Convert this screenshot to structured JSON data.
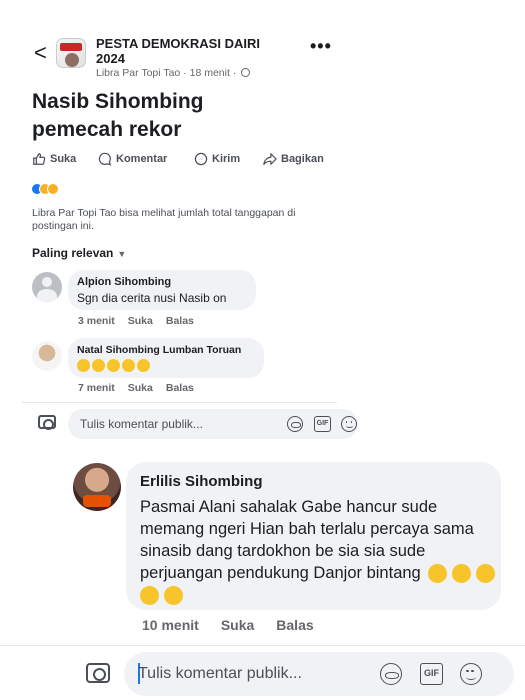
{
  "post": {
    "group_name_line1": "PESTA DEMOKRASI DAIRI",
    "group_name_line2": "2024",
    "author": "Libra Par Topi Tao",
    "time": "18 menit",
    "title_line1": "Nasib Sihombing",
    "title_line2": "pemecah rekor",
    "more_label": "•••",
    "back_label": "<"
  },
  "actions": {
    "like": "Suka",
    "comment": "Komentar",
    "send": "Kirim",
    "share": "Bagikan"
  },
  "reach_note": "Libra Par Topi Tao bisa melihat jumlah total tanggapan di postingan ini.",
  "filter_label": "Paling relevan",
  "comments": [
    {
      "name": "Alpion Sihombing",
      "text": "Sgn dia cerita nusi Nasib on",
      "time": "3 menit",
      "like": "Suka",
      "reply": "Balas"
    },
    {
      "name": "Natal Sihombing Lumban Toruan",
      "time": "7 menit",
      "like": "Suka",
      "reply": "Balas"
    }
  ],
  "composer_small": {
    "placeholder": "Tulis komentar publik..."
  },
  "big_comment": {
    "name": "Erlilis Sihombing",
    "text": "Pasmai Alani sahalak Gabe hancur sude memang ngeri Hian bah terlalu percaya sama sinasib dang tardokhon be sia sia sude perjuangan pendukung Danjor bintang",
    "time": "10 menit",
    "like": "Suka",
    "reply": "Balas"
  },
  "composer_large": {
    "placeholder": "Tulis komentar publik..."
  },
  "gif_label": "GIF",
  "colors": {
    "accent": "#1877f2",
    "bubble": "#f0f2f5",
    "muted": "#65676b",
    "emoji": "#f7c52b"
  }
}
